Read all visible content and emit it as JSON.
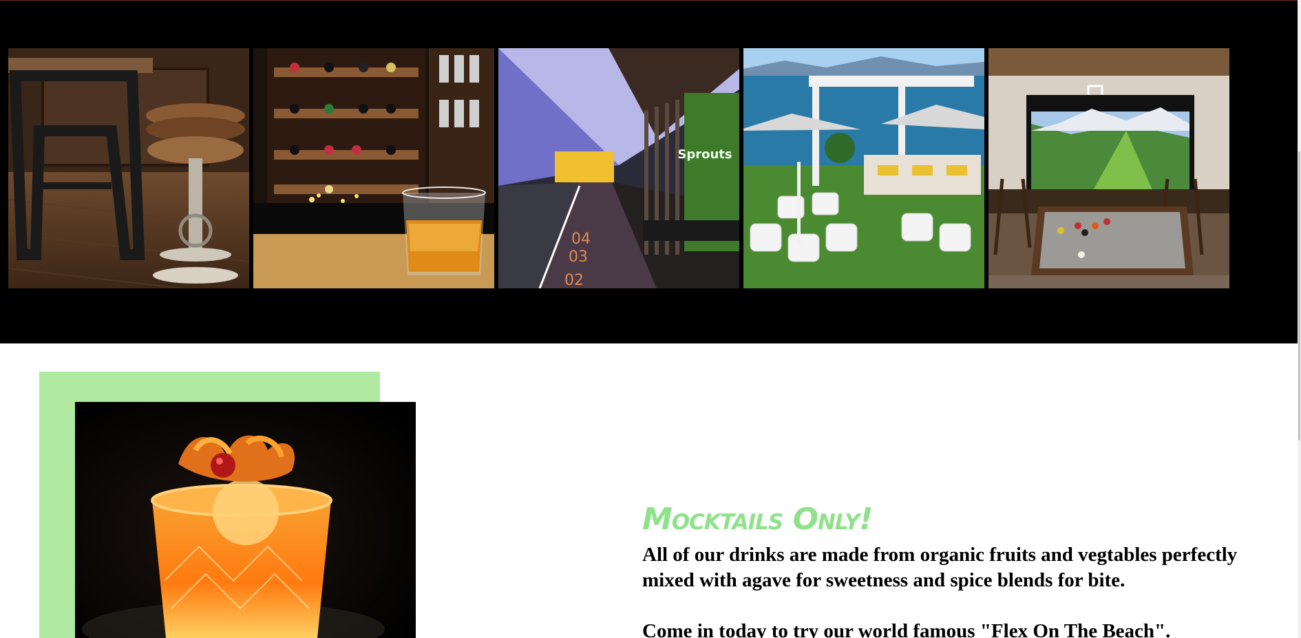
{
  "gallery": {
    "tiles": [
      {
        "icon": "bar-stool-photo"
      },
      {
        "icon": "whiskey-glass-photo"
      },
      {
        "icon": "fitness-lounge-photo",
        "sign_text": "Sprouts",
        "lane_numbers": [
          "02",
          "03",
          "04"
        ]
      },
      {
        "icon": "rooftop-patio-photo"
      },
      {
        "icon": "golf-simulator-billiards-photo"
      }
    ],
    "background": "#000000"
  },
  "promo": {
    "frame_color": "#b0eaa0",
    "image_icon": "mocktail-glass-photo",
    "headline": "Mocktails Only!",
    "headline_color": "#8fe28a",
    "paragraph_1": "All of our drinks are made from organic fruits and vegtables perfectly mixed with agave for sweetness and spice blends for bite.",
    "paragraph_2": "Come in today to try our world famous \"Flex On The Beach\"."
  }
}
